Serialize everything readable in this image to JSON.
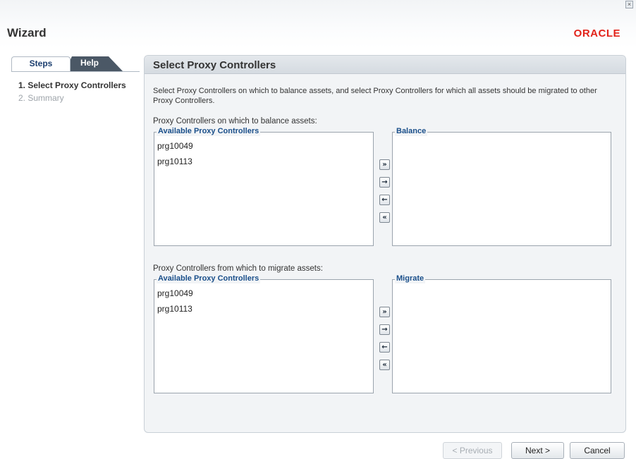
{
  "window": {
    "title": "Wizard",
    "brand": "ORACLE",
    "close_glyph": "×"
  },
  "tabs": {
    "steps": "Steps",
    "help": "Help"
  },
  "steps": [
    {
      "label": "1. Select Proxy Controllers",
      "active": true
    },
    {
      "label": "2. Summary",
      "active": false
    }
  ],
  "main": {
    "title": "Select Proxy Controllers",
    "description": "Select Proxy Controllers on which to balance assets, and select Proxy Controllers for which all assets should be migrated to other Proxy Controllers.",
    "balance_section": {
      "label": "Proxy Controllers on which to balance assets:",
      "available_legend": "Available Proxy Controllers",
      "available_items": [
        "prg10049",
        "prg10113"
      ],
      "selected_legend": "Balance",
      "selected_items": []
    },
    "migrate_section": {
      "label": "Proxy Controllers from which to migrate assets:",
      "available_legend": "Available Proxy Controllers",
      "available_items": [
        "prg10049",
        "prg10113"
      ],
      "selected_legend": "Migrate",
      "selected_items": []
    },
    "shuttle": {
      "move_all": "»",
      "move": "→",
      "remove": "←",
      "remove_all": "«"
    }
  },
  "footer": {
    "previous": "< Previous",
    "next": "Next >",
    "cancel": "Cancel"
  },
  "colors": {
    "brand_red": "#e2231a",
    "legend_blue": "#1a4f8a",
    "help_tab": "#4b5866"
  }
}
